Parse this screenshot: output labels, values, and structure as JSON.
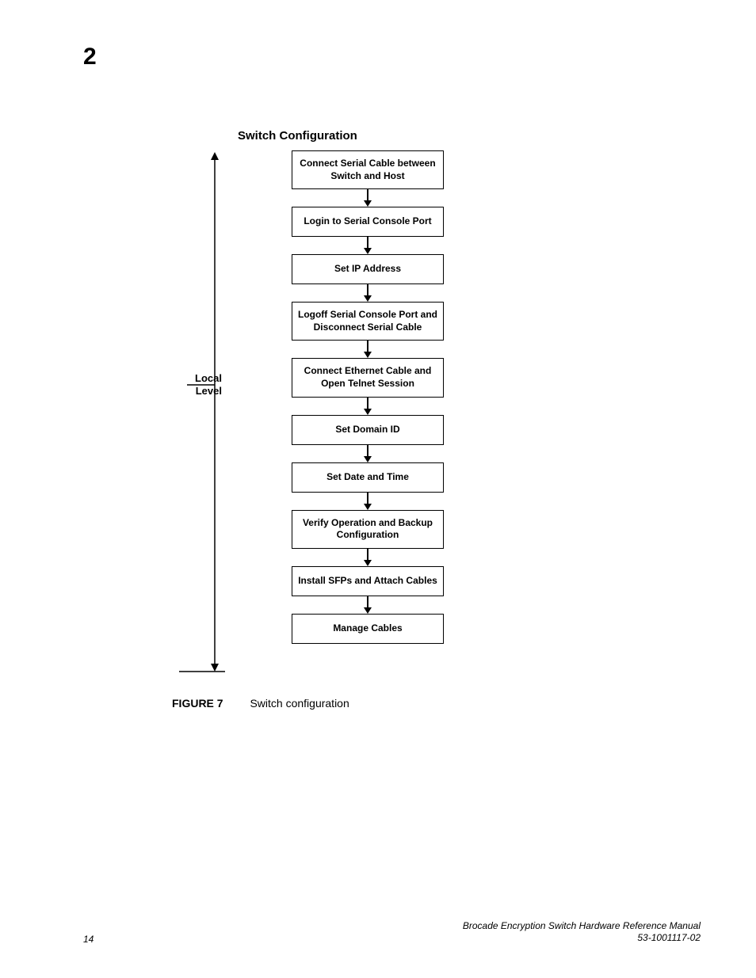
{
  "chapter": "2",
  "diagram": {
    "title": "Switch Configuration",
    "side_label_line1": "Local",
    "side_label_line2": "Level",
    "steps": [
      "Connect Serial Cable between Switch and Host",
      "Login to Serial Console Port",
      "Set IP Address",
      "Logoff Serial Console Port and Disconnect Serial Cable",
      "Connect Ethernet Cable and Open Telnet Session",
      "Set Domain ID",
      "Set Date and Time",
      "Verify Operation and Backup Configuration",
      "Install SFPs and Attach Cables",
      "Manage Cables"
    ]
  },
  "caption": {
    "label": "FIGURE 7",
    "text": "Switch configuration"
  },
  "footer": {
    "page": "14",
    "doc_title": "Brocade Encryption Switch Hardware Reference Manual",
    "doc_num": "53-1001117-02"
  }
}
